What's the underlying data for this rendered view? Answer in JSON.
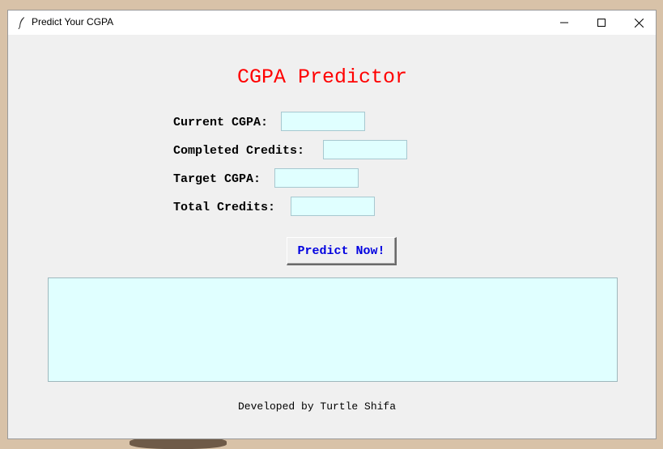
{
  "window": {
    "title": "Predict Your CGPA",
    "icon": "feather-icon",
    "controls": [
      "minimize",
      "maximize",
      "close"
    ]
  },
  "app": {
    "heading": "CGPA Predictor",
    "fields": {
      "current_cgpa": {
        "label": "Current CGPA:",
        "value": ""
      },
      "completed_credits": {
        "label": "Completed Credits:",
        "value": ""
      },
      "target_cgpa": {
        "label": "Target CGPA:",
        "value": ""
      },
      "total_credits": {
        "label": "Total Credits:",
        "value": ""
      }
    },
    "predict_button": "Predict Now!",
    "output_text": "",
    "footer": "Developed by Turtle Shifa"
  },
  "colors": {
    "heading": "#ff0000",
    "entry_bg": "#e0ffff",
    "button_text": "#0000e0",
    "window_bg": "#f0f0f0"
  }
}
